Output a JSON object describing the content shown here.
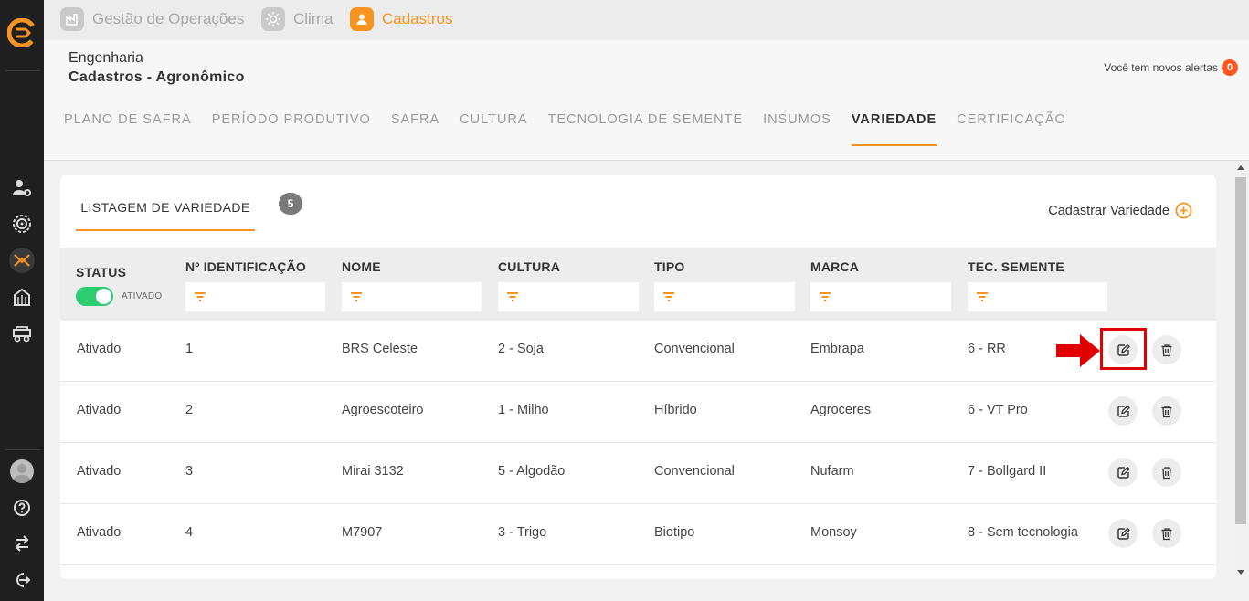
{
  "app_tabs": [
    {
      "label": "Gestão de Operações",
      "icon": "factory-icon"
    },
    {
      "label": "Clima",
      "icon": "sun-icon"
    },
    {
      "label": "Cadastros",
      "icon": "user-icon"
    }
  ],
  "breadcrumb": {
    "line1": "Engenharia",
    "line2": "Cadastros - Agronômico"
  },
  "alerts": {
    "text": "Você tem novos alertas",
    "count": "0"
  },
  "subnav": [
    "PLANO DE SAFRA",
    "PERÍODO PRODUTIVO",
    "SAFRA",
    "CULTURA",
    "TECNOLOGIA DE SEMENTE",
    "INSUMOS",
    "VARIEDADE",
    "CERTIFICAÇÃO"
  ],
  "subnav_active": "VARIEDADE",
  "list": {
    "tab_label": "LISTAGEM DE VARIEDADE",
    "count": "5",
    "add_label": "Cadastrar Variedade"
  },
  "table": {
    "headers": {
      "status": "STATUS",
      "id": "Nº IDENTIFICAÇÃO",
      "nome": "NOME",
      "cultura": "CULTURA",
      "tipo": "TIPO",
      "marca": "MARCA",
      "tec": "TEC. SEMENTE"
    },
    "status_toggle_label": "ATIVADO",
    "rows": [
      {
        "status": "Ativado",
        "id": "1",
        "nome": "BRS Celeste",
        "cultura": "2 - Soja",
        "tipo": "Convencional",
        "marca": "Embrapa",
        "tec": "6 - RR"
      },
      {
        "status": "Ativado",
        "id": "2",
        "nome": "Agroescoteiro",
        "cultura": "1 - Milho",
        "tipo": "Híbrido",
        "marca": "Agroceres",
        "tec": "6 - VT Pro"
      },
      {
        "status": "Ativado",
        "id": "3",
        "nome": "Mirai 3132",
        "cultura": "5 - Algodão",
        "tipo": "Convencional",
        "marca": "Nufarm",
        "tec": "7 - Bollgard II"
      },
      {
        "status": "Ativado",
        "id": "4",
        "nome": "M7907",
        "cultura": "3 - Trigo",
        "tipo": "Biotipo",
        "marca": "Monsoy",
        "tec": "8 - Sem tecnologia"
      }
    ]
  },
  "colors": {
    "accent": "#f7931e",
    "sidebar": "#1f1f1f",
    "toggle": "#2ecc71",
    "highlight": "#e00000"
  }
}
